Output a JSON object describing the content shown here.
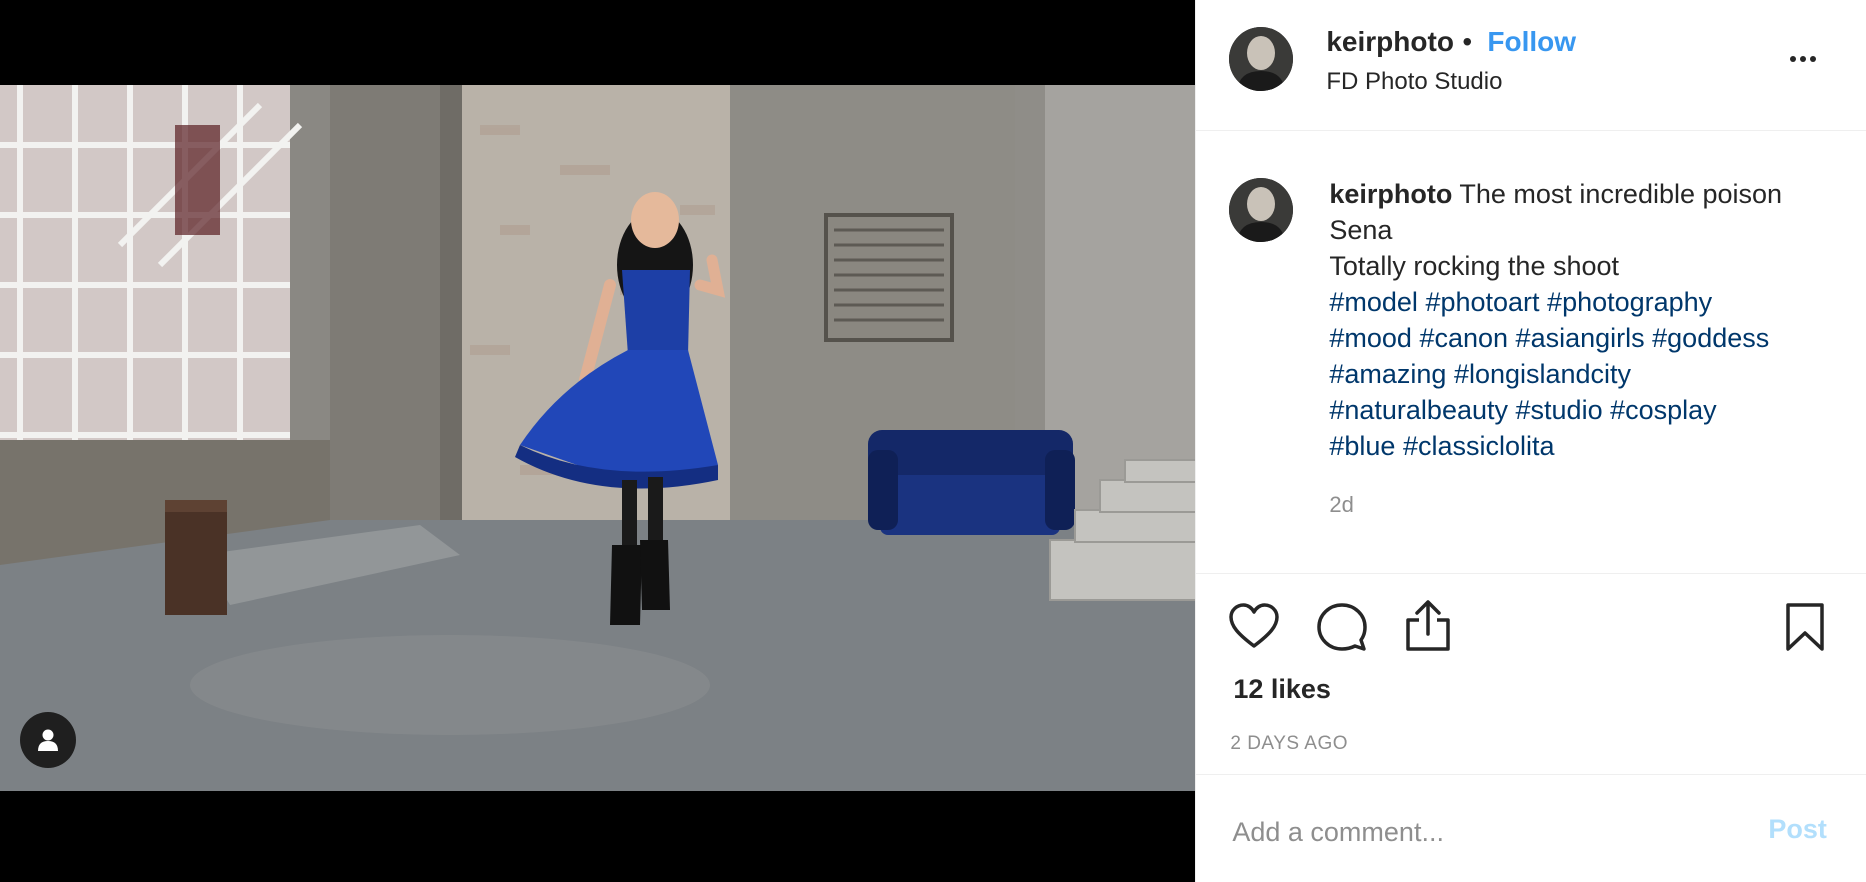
{
  "media": {
    "tag_icon": "user-icon"
  },
  "header": {
    "username": "keirphoto",
    "separator": "•",
    "follow_label": "Follow",
    "location": "FD Photo Studio",
    "more_icon": "more-horizontal-icon"
  },
  "caption": {
    "username": "keirphoto",
    "line1": "The most incredible poison Sena",
    "line2": "Totally rocking the shoot",
    "hashtags": [
      "#model",
      "#photoart",
      "#photography",
      "#mood",
      "#canon",
      "#asiangirls",
      "#goddess",
      "#amazing",
      "#longislandcity",
      "#naturalbeauty",
      "#studio",
      "#cosplay",
      "#blue",
      "#classiclolita"
    ],
    "time": "2d"
  },
  "actions": {
    "like_icon": "heart-icon",
    "comment_icon": "comment-icon",
    "share_icon": "share-icon",
    "save_icon": "bookmark-icon",
    "likes": "12 likes",
    "posted": "2 DAYS AGO"
  },
  "comment": {
    "placeholder": "Add a comment...",
    "post_label": "Post"
  },
  "colors": {
    "follow": "#3897f0",
    "hashtag": "#00376b",
    "post_disabled": "#b2dffc",
    "muted": "#8e8e8e",
    "dress": "#1c3fa8"
  }
}
